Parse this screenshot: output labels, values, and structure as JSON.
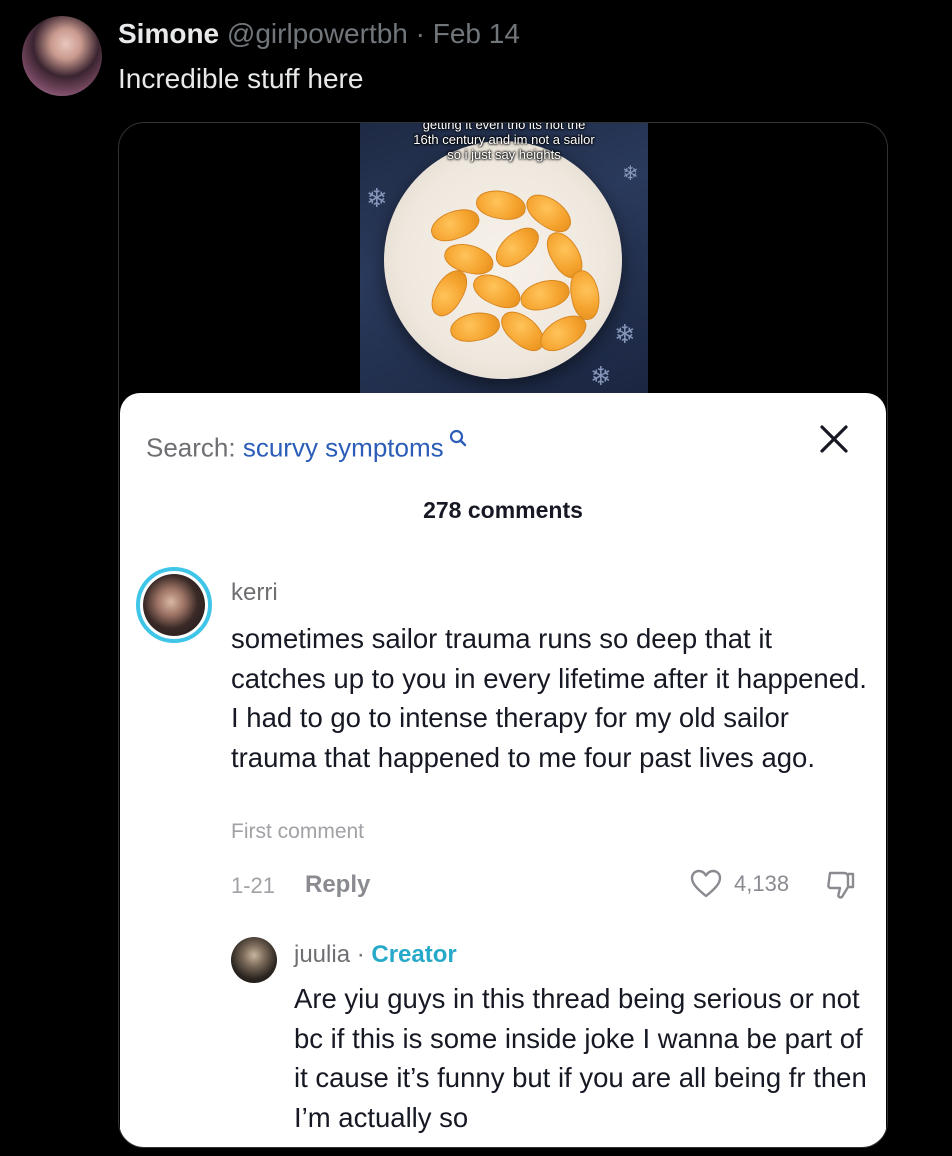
{
  "tweet": {
    "display_name": "Simone",
    "meta": "@girlpowertbh · Feb 14",
    "text": "Incredible stuff here"
  },
  "video": {
    "caption_line1": "getting it even tho its not the",
    "caption_line2": "16th century and im not a sailor",
    "caption_line3": "so i just say heights"
  },
  "sheet": {
    "search_label": "Search: ",
    "search_term": "scurvy symptoms",
    "search_icon": "search-icon",
    "close_glyph": "✕",
    "comments_count": "278 comments"
  },
  "comment": {
    "username": "kerri",
    "text": "sometimes sailor trauma runs so deep that it catches up to you in every lifetime after it happened. I had to go to intense therapy for my old sailor trauma that happened to me four past lives ago.",
    "label": "First comment",
    "date": "1-21",
    "reply_label": "Reply",
    "likes": "4,138"
  },
  "reply": {
    "username": "juulia · ",
    "badge": "Creator",
    "text": "Are yiu guys in this thread being serious or not bc if this is some inside joke I wanna be part of it cause it’s funny but if you are all being fr then I’m actually so"
  },
  "colors": {
    "background": "#000000",
    "search_accent": "#2b5db8",
    "creator_accent": "#27a9c9",
    "avatar_ring": "#3fc5e8"
  }
}
